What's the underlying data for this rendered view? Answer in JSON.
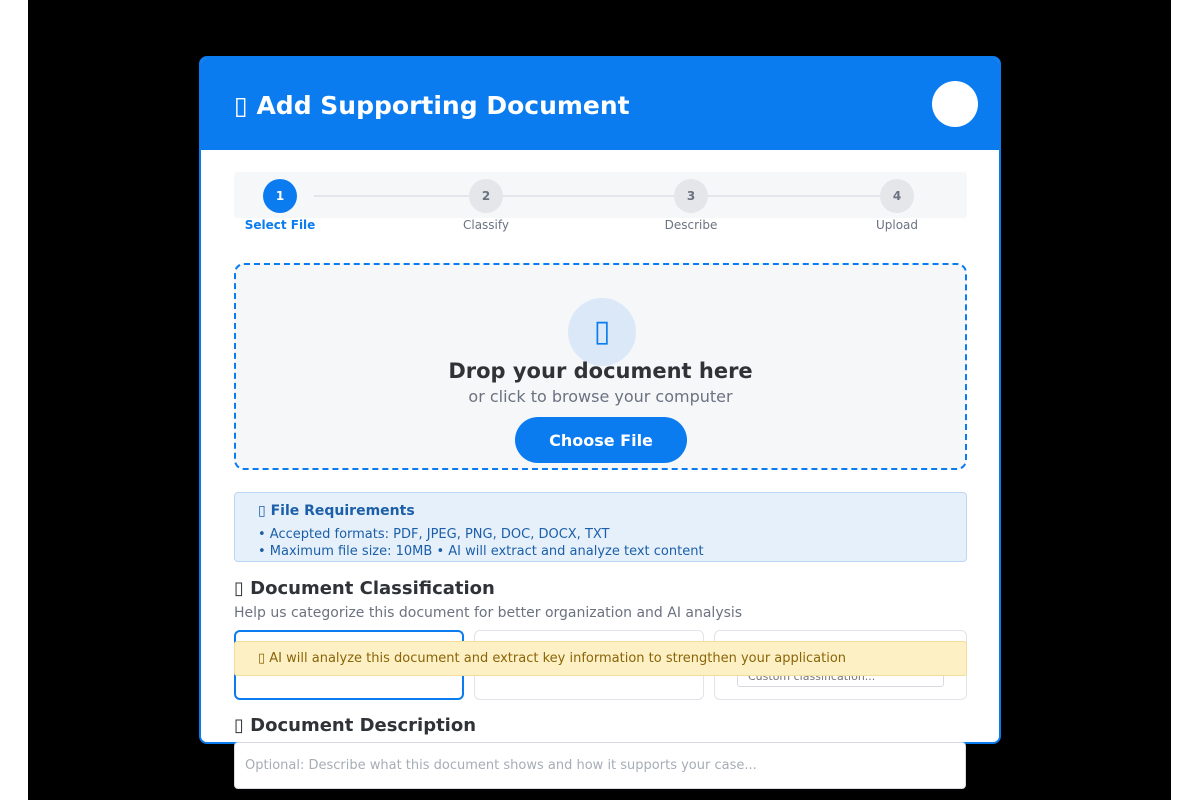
{
  "modal": {
    "title": "▯ Add Supporting Document"
  },
  "steps": [
    {
      "number": "1",
      "label": "Select File",
      "active": true
    },
    {
      "number": "2",
      "label": "Classify",
      "active": false
    },
    {
      "number": "3",
      "label": "Describe",
      "active": false
    },
    {
      "number": "4",
      "label": "Upload",
      "active": false
    }
  ],
  "dropzone": {
    "icon": "▯",
    "title": "Drop your document here",
    "subtitle": "or click to browse your computer",
    "button_label": "Choose File"
  },
  "requirements": {
    "title": "▯ File Requirements",
    "line1": "• Accepted formats: PDF, JPEG, PNG, DOC, DOCX, TXT",
    "line2": "• Maximum file size: 10MB • AI will extract and analyze text content"
  },
  "classification": {
    "title": "▯ Document Classification",
    "subtitle": "Help us categorize this document for better organization and AI analysis",
    "custom_placeholder": "Custom classification..."
  },
  "ai_notice": "▯ AI will analyze this document and extract key information to strengthen your application",
  "description": {
    "title": "▯ Document Description",
    "placeholder": "Optional: Describe what this document shows and how it supports your case..."
  },
  "colors": {
    "primary": "#0a7cf0",
    "notice_bg": "#fdf0c4",
    "info_bg": "#e5f0fb"
  }
}
